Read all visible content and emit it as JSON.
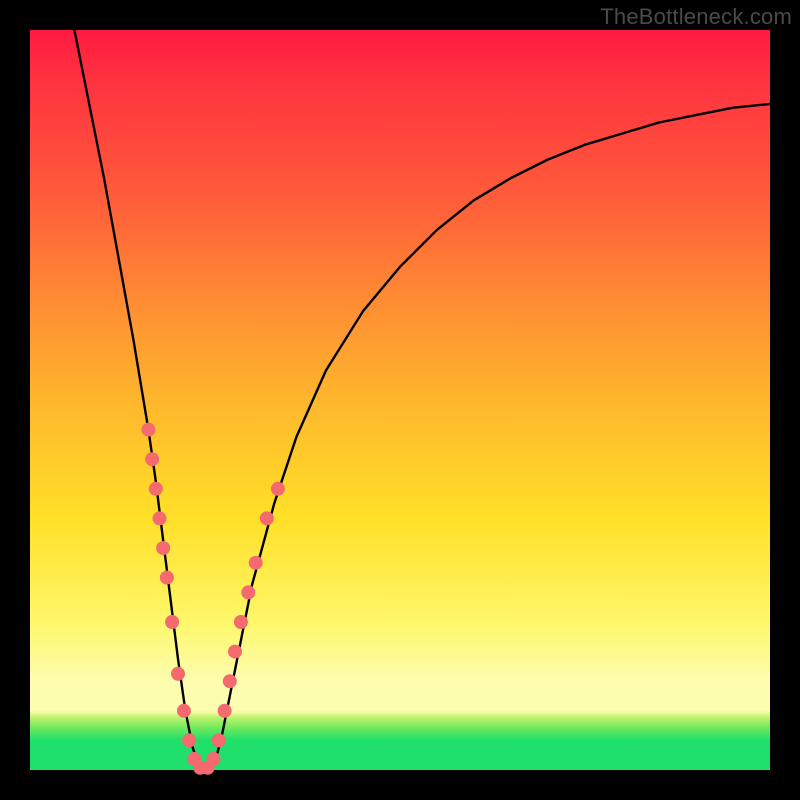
{
  "watermark": "TheBottleneck.com",
  "chart_data": {
    "type": "line",
    "title": "",
    "xlabel": "",
    "ylabel": "",
    "xlim": [
      0,
      100
    ],
    "ylim": [
      0,
      100
    ],
    "grid": false,
    "series": [
      {
        "name": "bottleneck-curve",
        "x": [
          6,
          8,
          10,
          12,
          14,
          16,
          17,
          18,
          19,
          20,
          21,
          22,
          23,
          24,
          25,
          26,
          28,
          30,
          33,
          36,
          40,
          45,
          50,
          55,
          60,
          65,
          70,
          75,
          80,
          85,
          90,
          95,
          100
        ],
        "y": [
          100,
          90,
          80,
          69,
          58,
          46,
          39,
          31,
          23,
          15,
          8,
          3,
          0,
          0,
          1,
          5,
          15,
          25,
          36,
          45,
          54,
          62,
          68,
          73,
          77,
          80,
          82.5,
          84.5,
          86,
          87.5,
          88.5,
          89.5,
          90
        ]
      }
    ],
    "markers": {
      "name": "highlighted-points",
      "color": "#f46a6f",
      "points": [
        {
          "x": 16.0,
          "y": 46
        },
        {
          "x": 16.5,
          "y": 42
        },
        {
          "x": 17.0,
          "y": 38
        },
        {
          "x": 17.5,
          "y": 34
        },
        {
          "x": 18.0,
          "y": 30
        },
        {
          "x": 18.5,
          "y": 26
        },
        {
          "x": 19.2,
          "y": 20
        },
        {
          "x": 20.0,
          "y": 13
        },
        {
          "x": 20.8,
          "y": 8
        },
        {
          "x": 21.5,
          "y": 4
        },
        {
          "x": 22.2,
          "y": 1.5
        },
        {
          "x": 23.0,
          "y": 0.3
        },
        {
          "x": 24.0,
          "y": 0.3
        },
        {
          "x": 24.8,
          "y": 1.5
        },
        {
          "x": 25.5,
          "y": 4
        },
        {
          "x": 26.3,
          "y": 8
        },
        {
          "x": 27.0,
          "y": 12
        },
        {
          "x": 27.7,
          "y": 16
        },
        {
          "x": 28.5,
          "y": 20
        },
        {
          "x": 29.5,
          "y": 24
        },
        {
          "x": 30.5,
          "y": 28
        },
        {
          "x": 32.0,
          "y": 34
        },
        {
          "x": 33.5,
          "y": 38
        }
      ]
    }
  }
}
